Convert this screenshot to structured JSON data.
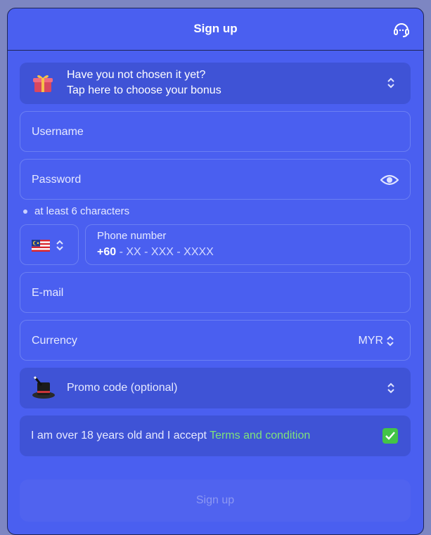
{
  "header": {
    "title": "Sign up"
  },
  "bonus": {
    "line1": "Have you not chosen it yet?",
    "line2": "Tap here to choose your bonus"
  },
  "username": {
    "placeholder": "Username"
  },
  "password": {
    "placeholder": "Password",
    "hint": "at least 6 characters"
  },
  "phone": {
    "country_flag": "MY",
    "label": "Phone number",
    "prefix": "+60",
    "mask": " - XX - XXX - XXXX"
  },
  "email": {
    "placeholder": "E-mail"
  },
  "currency": {
    "label": "Currency",
    "value": "MYR"
  },
  "promo": {
    "label": "Promo code (optional)"
  },
  "terms": {
    "text": "I am over 18 years old and I accept ",
    "link": "Terms and condition",
    "checked": true
  },
  "submit": {
    "label": "Sign up"
  },
  "colors": {
    "background": "#7d86c2",
    "panel": "#4a5ff0",
    "accent_green": "#43c447",
    "link_green": "#7fe27a"
  }
}
